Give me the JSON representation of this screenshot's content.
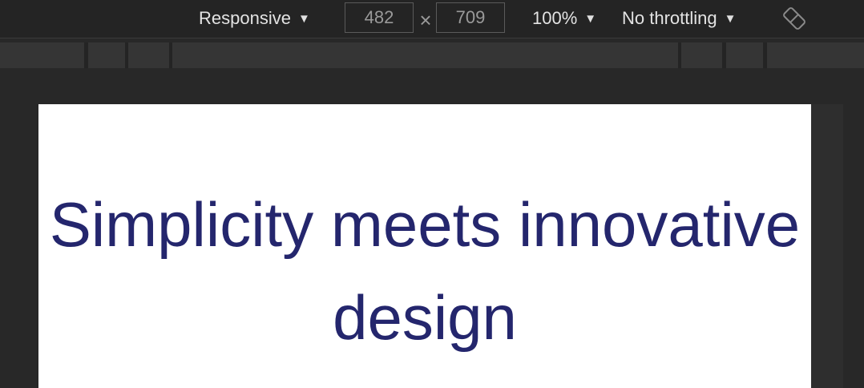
{
  "toolbar": {
    "device_label": "Responsive",
    "width_value": "482",
    "times_glyph": "×",
    "height_value": "709",
    "zoom_label": "100%",
    "throttle_label": "No throttling",
    "caret_glyph": "▼",
    "rotate_icon": "rotate-device-icon"
  },
  "page": {
    "heading": "Simplicity meets innovative design",
    "heading_color": "#24266d",
    "background": "#ffffff"
  }
}
